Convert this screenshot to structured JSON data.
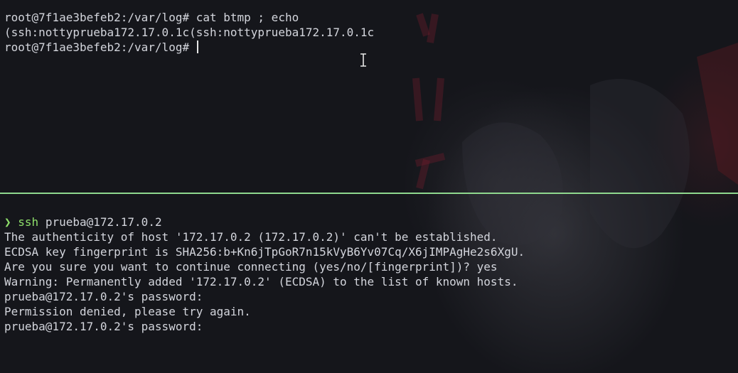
{
  "top_pane": {
    "lines": [
      "root@7f1ae3befeb2:/var/log# cat btmp ; echo",
      "(ssh:nottyprueba172.17.0.1c(ssh:nottyprueba172.17.0.1c",
      "root@7f1ae3befeb2:/var/log# "
    ]
  },
  "bottom_pane": {
    "prompt_symbol": "❯",
    "command_name": "ssh",
    "command_args": " prueba@172.17.0.2",
    "lines": [
      "The authenticity of host '172.17.0.2 (172.17.0.2)' can't be established.",
      "ECDSA key fingerprint is SHA256:b+Kn6jTpGoR7n15kVyB6Yv07Cq/X6jIMPAgHe2s6XgU.",
      "Are you sure you want to continue connecting (yes/no/[fingerprint])? yes",
      "Warning: Permanently added '172.17.0.2' (ECDSA) to the list of known hosts.",
      "prueba@172.17.0.2's password:",
      "Permission denied, please try again.",
      "prueba@172.17.0.2's password:"
    ]
  },
  "colors": {
    "background": "#15161b",
    "text": "#d3d5dc",
    "accent_green": "#8fe06b",
    "divider": "#8fd88e"
  },
  "icons": {
    "mouse_cursor": "text-ibeam-cursor-icon"
  }
}
